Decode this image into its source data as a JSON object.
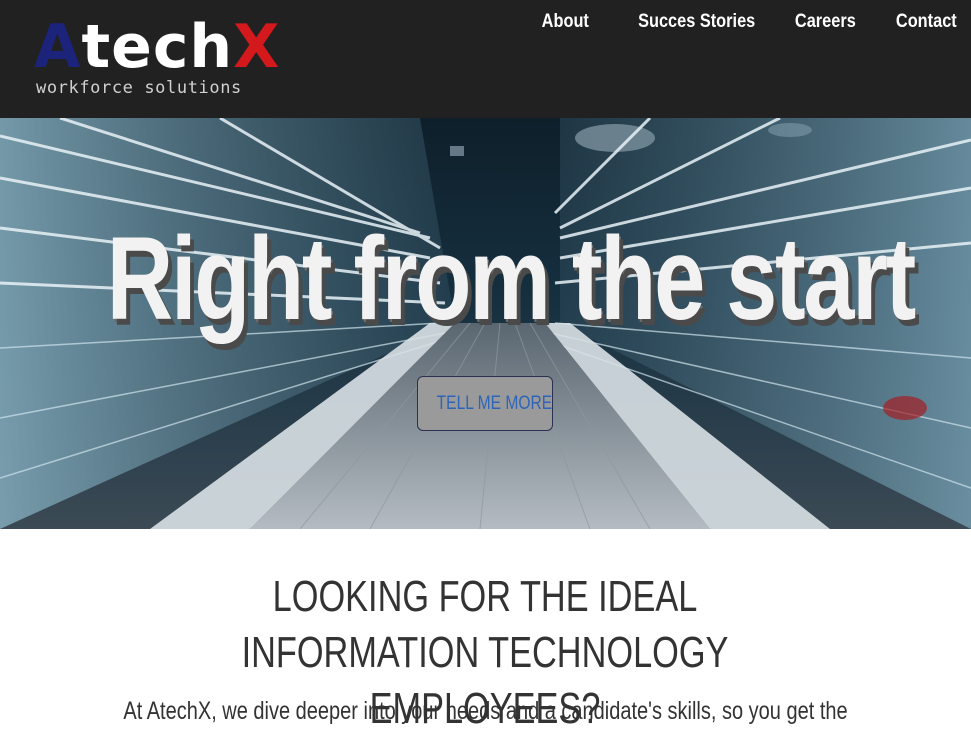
{
  "brand": {
    "logo_first": "A",
    "logo_mid": "tech",
    "logo_last": "X",
    "tagline": "workforce solutions",
    "colors": {
      "blue": "#1b237a",
      "white": "#ffffff",
      "red": "#d3191c"
    }
  },
  "nav": {
    "items": [
      {
        "label": "About"
      },
      {
        "label": "Succes Stories"
      },
      {
        "label": "Careers"
      },
      {
        "label": "Contact"
      }
    ]
  },
  "hero": {
    "title": "Right from the start",
    "button_label": "TELL ME MORE",
    "background_image": "moving-walkway-tunnel",
    "button_text_color": "#2e64b8"
  },
  "content": {
    "headline": "LOOKING FOR THE IDEAL INFORMATION TECHNOLOGY EMPLOYEES?",
    "intro": "At AtechX, we dive deeper into your needs and a candidate's skills, so you get the"
  }
}
